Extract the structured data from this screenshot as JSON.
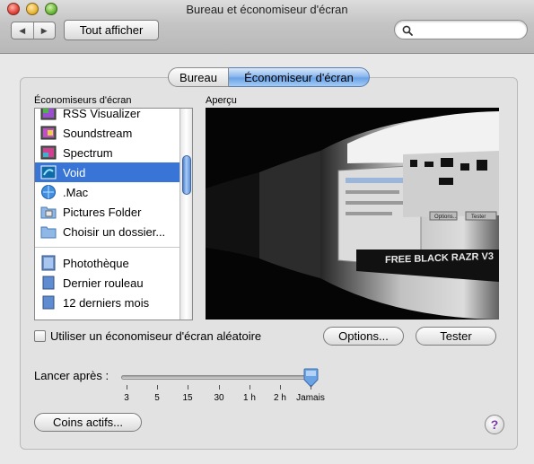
{
  "window": {
    "title": "Bureau et économiseur d'écran"
  },
  "toolbar": {
    "back_icon": "back-arrow-icon",
    "forward_icon": "forward-arrow-icon",
    "show_all_label": "Tout afficher",
    "search_placeholder": "",
    "search_value": ""
  },
  "tabs": [
    {
      "label": "Bureau",
      "active": false
    },
    {
      "label": "Économiseur d'écran",
      "active": true
    }
  ],
  "screensavers": {
    "header": "Économiseurs d'écran",
    "items": [
      {
        "label": "RSS Visualizer",
        "icon": "rss-visualizer-icon",
        "selected": false
      },
      {
        "label": "Soundstream",
        "icon": "soundstream-icon",
        "selected": false
      },
      {
        "label": "Spectrum",
        "icon": "spectrum-icon",
        "selected": false
      },
      {
        "label": "Void",
        "icon": "void-icon",
        "selected": true
      },
      {
        "label": ".Mac",
        "icon": "dotmac-globe-icon",
        "selected": false
      },
      {
        "label": "Pictures Folder",
        "icon": "pictures-folder-icon",
        "selected": false
      },
      {
        "label": "Choisir un dossier...",
        "icon": "folder-icon",
        "selected": false
      }
    ],
    "library_items": [
      {
        "label": "Photothèque",
        "icon": "photo-library-icon"
      },
      {
        "label": "Dernier rouleau",
        "icon": "roll-icon"
      },
      {
        "label": "12 derniers mois",
        "icon": "roll-icon"
      }
    ]
  },
  "preview": {
    "header": "Aperçu",
    "window_text": "FREE BLACK RAZR V3",
    "window_buttons": [
      "Options...",
      "Tester"
    ]
  },
  "random": {
    "label": "Utiliser un économiseur d'écran aléatoire",
    "checked": false
  },
  "buttons": {
    "options_label": "Options...",
    "test_label": "Tester",
    "hot_corners_label": "Coins actifs...",
    "help_label": "?"
  },
  "slider": {
    "label": "Lancer après :",
    "ticks": [
      "3",
      "5",
      "15",
      "30",
      "1 h",
      "2 h",
      "Jamais"
    ],
    "selected_value": "Jamais"
  },
  "colors": {
    "selection": "#3875d7",
    "accent": "#6aa2e6"
  }
}
